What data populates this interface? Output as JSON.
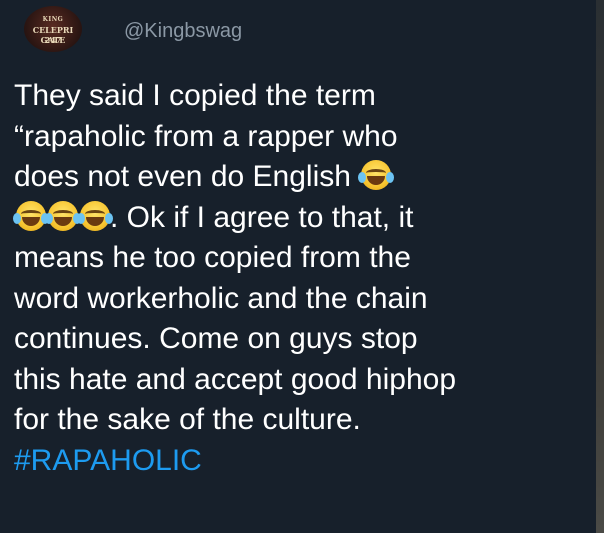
{
  "avatar": {
    "logo_line1": "KING",
    "logo_line2": "CELEPRI GATE",
    "logo_line3": "247"
  },
  "tweet": {
    "handle": "@Kingbswag",
    "lines": [
      "They said I copied the term",
      "“rapaholic from a rapper who",
      "does not even do English",
      ". Ok if I agree to that, it",
      "means he too copied from the",
      "word workerholic and the chain",
      "continues. Come on guys stop",
      "this hate and accept good hiphop",
      "for the sake of the culture."
    ],
    "hashtag": "#RAPAHOLIC",
    "emojis": [
      "face-with-tears-of-joy-icon"
    ]
  },
  "colors": {
    "background": "#17202b",
    "text": "#ffffff",
    "handle": "#8b98a5",
    "hashtag": "#1d9bf0"
  }
}
